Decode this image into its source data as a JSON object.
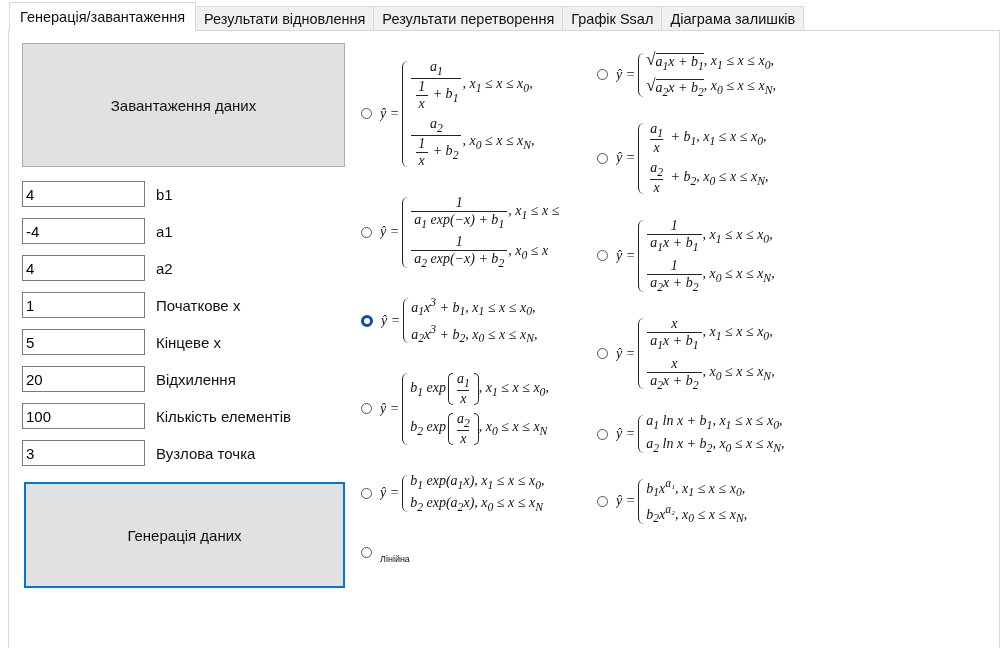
{
  "tabs": [
    {
      "label": "Генерація/завантаження",
      "selected": true
    },
    {
      "label": "Результати відновлення",
      "selected": false
    },
    {
      "label": "Результати перетворення",
      "selected": false
    },
    {
      "label": "Графік Ssал",
      "selected": false
    },
    {
      "label": "Діаграма залишків",
      "selected": false
    }
  ],
  "load_button": "Завантаження даних",
  "parameters": [
    {
      "value": "4",
      "label": "b1"
    },
    {
      "value": "-4",
      "label": "a1"
    },
    {
      "value": "4",
      "label": "a2"
    },
    {
      "value": "1",
      "label": "Початкове x"
    },
    {
      "value": "5",
      "label": "Кінцеве x"
    },
    {
      "value": "20",
      "label": "Відхилення"
    },
    {
      "value": "100",
      "label": "Кількість елементів"
    },
    {
      "value": "3",
      "label": "Вузлова точка"
    }
  ],
  "generate_button": "Генерація даних",
  "options_left": [
    {
      "kind": "formula",
      "selected": false,
      "lhs": "ŷ =",
      "cases": [
        [
          {
            "kind": "frac",
            "num": [
              {
                "kind": "text",
                "t": "a$_{1}$"
              }
            ],
            "den": [
              {
                "kind": "frac",
                "num": [
                  {
                    "kind": "text",
                    "t": "1"
                  }
                ],
                "den": [
                  {
                    "kind": "text",
                    "t": "x"
                  }
                ]
              },
              {
                "kind": "text",
                "t": " + b$_{1}$"
              }
            ]
          },
          {
            "kind": "text",
            "t": ", x$_{1}$ ≤ x ≤ x$_{0}$,"
          }
        ],
        [
          {
            "kind": "frac",
            "num": [
              {
                "kind": "text",
                "t": "a$_{2}$"
              }
            ],
            "den": [
              {
                "kind": "frac",
                "num": [
                  {
                    "kind": "text",
                    "t": "1"
                  }
                ],
                "den": [
                  {
                    "kind": "text",
                    "t": "x"
                  }
                ]
              },
              {
                "kind": "text",
                "t": " + b$_{2}$"
              }
            ]
          },
          {
            "kind": "text",
            "t": ", x$_{0}$ ≤ x ≤ x$_{N}$,"
          }
        ]
      ]
    },
    {
      "kind": "formula",
      "selected": false,
      "lhs": "ŷ =",
      "cases": [
        [
          {
            "kind": "frac",
            "num": [
              {
                "kind": "text",
                "t": "1"
              }
            ],
            "den": [
              {
                "kind": "text",
                "t": "a$_{1}$ exp(−x) + b$_{1}$"
              }
            ]
          },
          {
            "kind": "text",
            "t": ", x$_{1}$ ≤ x ≤"
          }
        ],
        [
          {
            "kind": "frac",
            "num": [
              {
                "kind": "text",
                "t": "1"
              }
            ],
            "den": [
              {
                "kind": "text",
                "t": "a$_{2}$ exp(−x) + b$_{2}$"
              }
            ]
          },
          {
            "kind": "text",
            "t": ", x$_{0}$ ≤ x"
          }
        ]
      ]
    },
    {
      "kind": "formula",
      "selected": true,
      "lhs": "ŷ =",
      "cases": [
        [
          {
            "kind": "text",
            "t": "a$_{1}$x$^{3}$ + b$_{1}$, x$_{1}$ ≤ x ≤ x$_{0}$,"
          }
        ],
        [
          {
            "kind": "text",
            "t": "a$_{2}$x$^{3}$ + b$_{2}$, x$_{0}$ ≤ x ≤ x$_{N}$,"
          }
        ]
      ]
    },
    {
      "kind": "formula",
      "selected": false,
      "lhs": "ŷ =",
      "cases": [
        [
          {
            "kind": "text",
            "t": "b$_{1}$ exp"
          },
          {
            "kind": "paren",
            "parts": [
              {
                "kind": "frac",
                "num": [
                  {
                    "kind": "text",
                    "t": "a$_{1}$"
                  }
                ],
                "den": [
                  {
                    "kind": "text",
                    "t": "x"
                  }
                ]
              }
            ]
          },
          {
            "kind": "text",
            "t": ", x$_{1}$ ≤ x ≤ x$_{0}$,"
          }
        ],
        [
          {
            "kind": "text",
            "t": "b$_{2}$ exp"
          },
          {
            "kind": "paren",
            "parts": [
              {
                "kind": "frac",
                "num": [
                  {
                    "kind": "text",
                    "t": "a$_{2}$"
                  }
                ],
                "den": [
                  {
                    "kind": "text",
                    "t": "x"
                  }
                ]
              }
            ]
          },
          {
            "kind": "text",
            "t": ", x$_{0}$ ≤ x ≤ x$_{N}$"
          }
        ]
      ]
    },
    {
      "kind": "formula",
      "selected": false,
      "lhs": "ŷ =",
      "cases": [
        [
          {
            "kind": "text",
            "t": "b$_{1}$ exp(a$_{1}$x), x$_{1}$ ≤ x ≤ x$_{0}$,"
          }
        ],
        [
          {
            "kind": "text",
            "t": "b$_{2}$ exp(a$_{2}$x), x$_{0}$ ≤ x ≤ x$_{N}$"
          }
        ]
      ]
    },
    {
      "kind": "text",
      "selected": false,
      "label": "Лінійна"
    }
  ],
  "options_right": [
    {
      "kind": "formula",
      "selected": false,
      "lhs": "ŷ =",
      "cases": [
        [
          {
            "kind": "sqrt",
            "sign": "√",
            "parts": [
              {
                "kind": "text",
                "t": "a$_{1}$x + b$_{1}$"
              }
            ]
          },
          {
            "kind": "text",
            "t": ", x$_{1}$ ≤ x ≤ x$_{0}$,"
          }
        ],
        [
          {
            "kind": "sqrt",
            "sign": "√",
            "parts": [
              {
                "kind": "text",
                "t": "a$_{2}$x + b$_{2}$"
              }
            ]
          },
          {
            "kind": "text",
            "t": ", x$_{0}$ ≤ x ≤ x$_{N}$,"
          }
        ]
      ]
    },
    {
      "kind": "formula",
      "selected": false,
      "lhs": "ŷ =",
      "cases": [
        [
          {
            "kind": "frac",
            "num": [
              {
                "kind": "text",
                "t": "a$_{1}$"
              }
            ],
            "den": [
              {
                "kind": "text",
                "t": "x"
              }
            ]
          },
          {
            "kind": "text",
            "t": " + b$_{1}$, x$_{1}$ ≤ x ≤ x$_{0}$,"
          }
        ],
        [
          {
            "kind": "frac",
            "num": [
              {
                "kind": "text",
                "t": "a$_{2}$"
              }
            ],
            "den": [
              {
                "kind": "text",
                "t": "x"
              }
            ]
          },
          {
            "kind": "text",
            "t": " + b$_{2}$, x$_{0}$ ≤ x ≤ x$_{N}$,"
          }
        ]
      ]
    },
    {
      "kind": "formula",
      "selected": false,
      "lhs": "ŷ =",
      "cases": [
        [
          {
            "kind": "frac",
            "num": [
              {
                "kind": "text",
                "t": "1"
              }
            ],
            "den": [
              {
                "kind": "text",
                "t": "a$_{1}$x + b$_{1}$"
              }
            ]
          },
          {
            "kind": "text",
            "t": ", x$_{1}$ ≤ x ≤ x$_{0}$,"
          }
        ],
        [
          {
            "kind": "frac",
            "num": [
              {
                "kind": "text",
                "t": "1"
              }
            ],
            "den": [
              {
                "kind": "text",
                "t": "a$_{2}$x + b$_{2}$"
              }
            ]
          },
          {
            "kind": "text",
            "t": ", x$_{0}$ ≤ x ≤ x$_{N}$,"
          }
        ]
      ]
    },
    {
      "kind": "formula",
      "selected": false,
      "lhs": "ŷ =",
      "cases": [
        [
          {
            "kind": "frac",
            "num": [
              {
                "kind": "text",
                "t": "x"
              }
            ],
            "den": [
              {
                "kind": "text",
                "t": "a$_{1}$x + b$_{1}$"
              }
            ]
          },
          {
            "kind": "text",
            "t": ", x$_{1}$ ≤ x ≤ x$_{0}$,"
          }
        ],
        [
          {
            "kind": "frac",
            "num": [
              {
                "kind": "text",
                "t": "x"
              }
            ],
            "den": [
              {
                "kind": "text",
                "t": "a$_{2}$x + b$_{2}$"
              }
            ]
          },
          {
            "kind": "text",
            "t": ", x$_{0}$ ≤ x ≤ x$_{N}$,"
          }
        ]
      ]
    },
    {
      "kind": "formula",
      "selected": false,
      "lhs": "ŷ =",
      "cases": [
        [
          {
            "kind": "text",
            "t": "a$_{1}$ ln x + b$_{1}$, x$_{1}$ ≤ x ≤ x$_{0}$,"
          }
        ],
        [
          {
            "kind": "text",
            "t": "a$_{2}$ ln x + b$_{2}$, x$_{0}$ ≤ x ≤ x$_{N}$,"
          }
        ]
      ]
    },
    {
      "kind": "formula",
      "selected": false,
      "lhs": "ŷ =",
      "cases": [
        [
          {
            "kind": "text",
            "t": "b$_{1}$x$^{a₁}$, x$_{1}$ ≤ x ≤ x$_{0}$,"
          }
        ],
        [
          {
            "kind": "text",
            "t": "b$_{2}$x$^{a₂}$, x$_{0}$ ≤ x ≤ x$_{N}$,"
          }
        ]
      ]
    }
  ]
}
